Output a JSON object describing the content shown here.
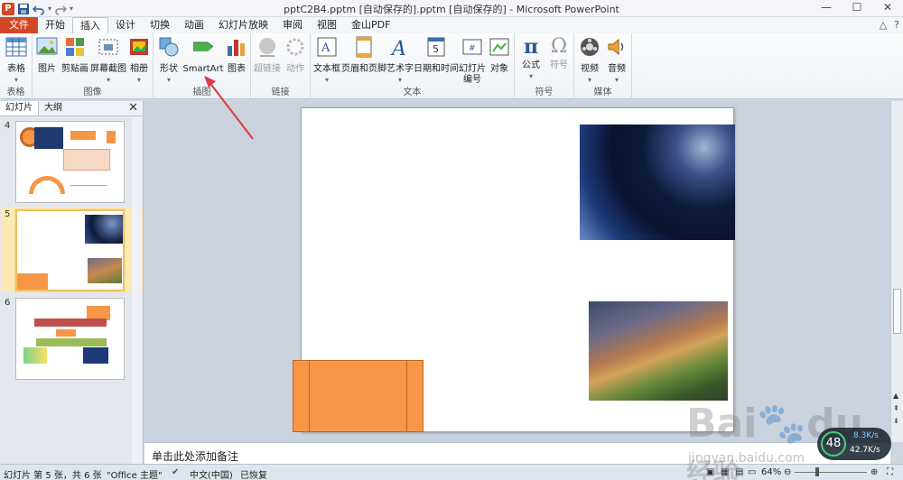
{
  "window": {
    "title": "pptC2B4.pptm [自动保存的].pptm [自动保存的] - Microsoft PowerPoint",
    "min": "—",
    "max": "☐",
    "close": "✕"
  },
  "tabs": [
    "文件",
    "开始",
    "插入",
    "设计",
    "切换",
    "动画",
    "幻灯片放映",
    "审阅",
    "视图",
    "金山PDF"
  ],
  "active_tab": "插入",
  "ribbon": {
    "groups": [
      {
        "label": "表格",
        "buttons": [
          {
            "label": "表格",
            "icon": "table-icon"
          }
        ]
      },
      {
        "label": "图像",
        "buttons": [
          {
            "label": "图片",
            "icon": "picture-icon"
          },
          {
            "label": "剪贴画",
            "icon": "clipart-icon"
          },
          {
            "label": "屏幕截图",
            "icon": "screenshot-icon"
          },
          {
            "label": "相册",
            "icon": "album-icon"
          }
        ]
      },
      {
        "label": "插图",
        "buttons": [
          {
            "label": "形状",
            "icon": "shapes-icon"
          },
          {
            "label": "SmartArt",
            "icon": "smartart-icon"
          },
          {
            "label": "图表",
            "icon": "chart-icon"
          }
        ]
      },
      {
        "label": "链接",
        "buttons": [
          {
            "label": "超链接",
            "icon": "hyperlink-icon"
          },
          {
            "label": "动作",
            "icon": "action-icon"
          }
        ]
      },
      {
        "label": "文本",
        "buttons": [
          {
            "label": "文本框",
            "icon": "textbox-icon"
          },
          {
            "label": "页眉和页脚",
            "icon": "header-footer-icon"
          },
          {
            "label": "艺术字",
            "icon": "wordart-icon"
          },
          {
            "label": "日期和时间",
            "icon": "datetime-icon"
          },
          {
            "label": "幻灯片",
            "label2": "编号",
            "icon": "slide-number-icon"
          },
          {
            "label": "对象",
            "icon": "object-icon"
          }
        ]
      },
      {
        "label": "符号",
        "buttons": [
          {
            "label": "公式",
            "icon": "equation-icon",
            "glyph": "π"
          },
          {
            "label": "符号",
            "icon": "symbol-icon",
            "glyph": "Ω"
          }
        ]
      },
      {
        "label": "媒体",
        "buttons": [
          {
            "label": "视频",
            "icon": "video-icon"
          },
          {
            "label": "音频",
            "icon": "audio-icon"
          }
        ]
      }
    ]
  },
  "panel": {
    "tabs": [
      "幻灯片",
      "大纲"
    ],
    "slides": [
      "4",
      "5",
      "6"
    ]
  },
  "notes_placeholder": "单击此处添加备注",
  "status": {
    "slide_info": "幻灯片 第 5 张，共 6 张",
    "theme": "\"Office 主题\"",
    "language": "中文(中国)",
    "recovered": "已恢复",
    "zoom": "64%"
  },
  "watermark": {
    "brand": "Bai",
    "brand2": "du",
    "brand_cn": "经验",
    "url": "jingyan.baidu.com",
    "speed_value": "48",
    "speed_up": "8.3K/s",
    "speed_down": "42.7K/s"
  },
  "colors": {
    "file_tab": "#d24726",
    "orange_shape": "#f79646",
    "arrow": "#e03a3a"
  }
}
